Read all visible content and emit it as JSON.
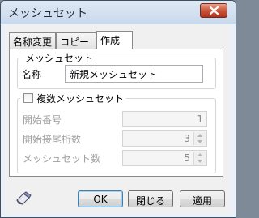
{
  "window": {
    "title": "メッシュセット"
  },
  "tabs": [
    {
      "label": "名称変更",
      "active": false
    },
    {
      "label": "コピー",
      "active": false
    },
    {
      "label": "作成",
      "active": true
    }
  ],
  "mesh_set_group": {
    "legend": "メッシュセット",
    "name_label": "名称",
    "name_value": "新規メッシュセット"
  },
  "multiple_group": {
    "checkbox_label": "複数メッシュセット",
    "checked": false,
    "start_number_label": "開始番号",
    "start_number_value": "1",
    "start_suffix_digits_label": "開始接尾桁数",
    "start_suffix_digits_value": "3",
    "mesh_set_count_label": "メッシュセット数",
    "mesh_set_count_value": "5"
  },
  "buttons": {
    "ok": "OK",
    "close": "閉じる",
    "apply": "適用"
  },
  "icons": {
    "close": "close-icon",
    "eraser": "eraser-icon",
    "spin_up": "chevron-up-icon",
    "spin_down": "chevron-down-icon"
  },
  "colors": {
    "close_button": "#c8553b",
    "default_button_border": "#3c7fb1",
    "disabled_text": "#a0a0a0"
  }
}
